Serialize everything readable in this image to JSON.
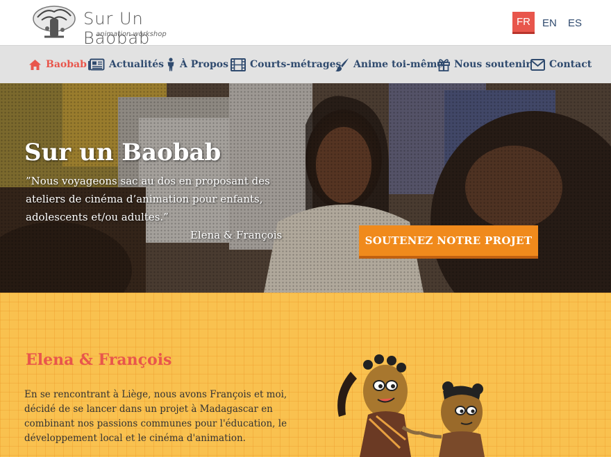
{
  "header": {
    "logo_title": "Sur Un Baobab",
    "logo_subtitle": "animation workshop",
    "languages": [
      {
        "code": "FR",
        "active": true
      },
      {
        "code": "EN",
        "active": false
      },
      {
        "code": "ES",
        "active": false
      }
    ]
  },
  "nav": {
    "items": [
      {
        "label": "Baobab",
        "icon": "home-icon",
        "active": true
      },
      {
        "label": "Actualités",
        "icon": "newspaper-icon"
      },
      {
        "label": "À Propos",
        "icon": "person-icon"
      },
      {
        "label": "Courts-métrages",
        "icon": "film-icon"
      },
      {
        "label": "Anime toi-même",
        "icon": "paintbrush-icon"
      },
      {
        "label": "Nous soutenir",
        "icon": "gift-icon"
      },
      {
        "label": "Contact",
        "icon": "envelope-icon"
      }
    ]
  },
  "hero": {
    "title": "Sur un Baobab",
    "quote": "”Nous voyageons sac au dos en proposant des ateliers de cinéma d’animation pour enfants, adolescents et/ou adultes.”",
    "author": "Elena & François",
    "cta_label": "SOUTENEZ NOTRE PROJET"
  },
  "section": {
    "title": "Elena & François",
    "text": "En se rencontrant à Liège, nous avons François et moi, décidé de se lancer dans un projet à Madagascar en combinant nos passions communes pour l'éducation, le développement local et le cinéma d'animation."
  },
  "colors": {
    "accent": "#e8564c",
    "nav_text": "#2f4a6e",
    "cta": "#f08a1c",
    "section_bg": "#f9c14f"
  }
}
